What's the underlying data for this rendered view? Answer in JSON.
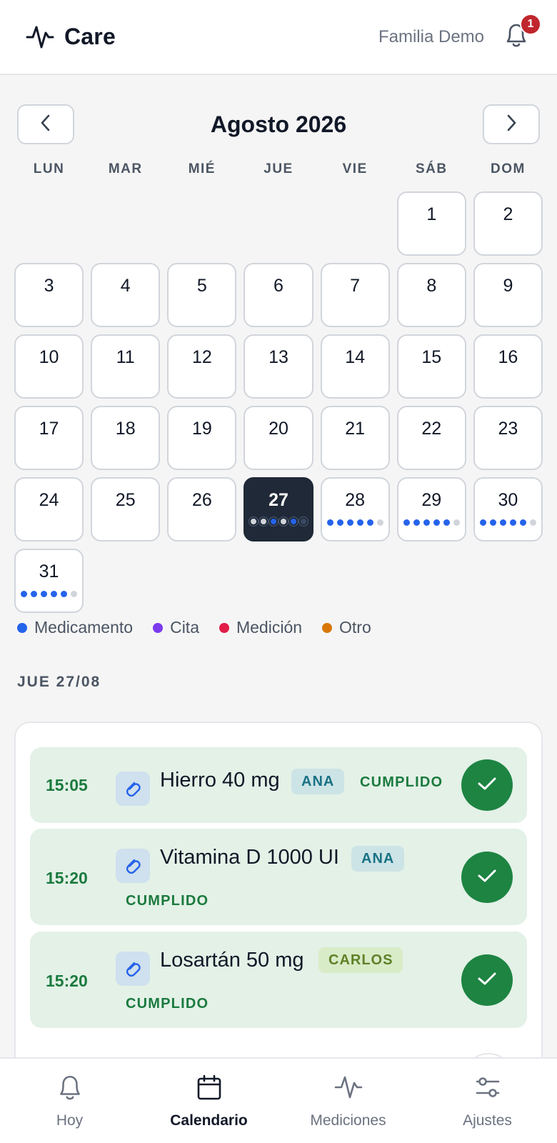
{
  "app": {
    "title": "Care",
    "family": "Familia Demo",
    "notifications": "1"
  },
  "calendar": {
    "month_title": "Agosto 2026",
    "weekdays": [
      "LUN",
      "MAR",
      "MIÉ",
      "JUE",
      "VIE",
      "SÁB",
      "DOM"
    ],
    "leading_blank_days": 5,
    "selected_day": 27,
    "days": [
      {
        "n": "1"
      },
      {
        "n": "2"
      },
      {
        "n": "3"
      },
      {
        "n": "4"
      },
      {
        "n": "5"
      },
      {
        "n": "6"
      },
      {
        "n": "7"
      },
      {
        "n": "8"
      },
      {
        "n": "9"
      },
      {
        "n": "10"
      },
      {
        "n": "11"
      },
      {
        "n": "12"
      },
      {
        "n": "13"
      },
      {
        "n": "14"
      },
      {
        "n": "15"
      },
      {
        "n": "16"
      },
      {
        "n": "17"
      },
      {
        "n": "18"
      },
      {
        "n": "19"
      },
      {
        "n": "20"
      },
      {
        "n": "21"
      },
      {
        "n": "22"
      },
      {
        "n": "23"
      },
      {
        "n": "24"
      },
      {
        "n": "25"
      },
      {
        "n": "26"
      },
      {
        "n": "27",
        "dots": [
          "pending",
          "pending",
          "done",
          "pending",
          "done",
          "empty"
        ]
      },
      {
        "n": "28",
        "dots": [
          "done",
          "done",
          "done",
          "done",
          "done",
          "pending"
        ]
      },
      {
        "n": "29",
        "dots": [
          "done",
          "done",
          "done",
          "done",
          "done",
          "pending"
        ]
      },
      {
        "n": "30",
        "dots": [
          "done",
          "done",
          "done",
          "done",
          "done",
          "pending"
        ]
      },
      {
        "n": "31",
        "dots": [
          "done",
          "done",
          "done",
          "done",
          "done",
          "pending"
        ]
      }
    ]
  },
  "legend": [
    {
      "label": "Medicamento",
      "color": "#2563eb"
    },
    {
      "label": "Cita",
      "color": "#7c3aed"
    },
    {
      "label": "Medición",
      "color": "#e11d48"
    },
    {
      "label": "Otro",
      "color": "#d97706"
    }
  ],
  "day_section": {
    "title": "JUE 27/08"
  },
  "events": [
    {
      "time": "15:05",
      "name": "Hierro 40 mg",
      "person": "ANA",
      "status": "CUMPLIDO"
    },
    {
      "time": "15:20",
      "name": "Vitamina D 1000 UI",
      "person": "ANA",
      "status": "CUMPLIDO"
    },
    {
      "time": "15:20",
      "name": "Losartán 50 mg",
      "person": "CARLOS",
      "status": "CUMPLIDO"
    }
  ],
  "bottom_nav": [
    {
      "label": "Hoy",
      "icon": "bell-icon"
    },
    {
      "label": "Calendario",
      "icon": "calendar-icon",
      "active": true
    },
    {
      "label": "Mediciones",
      "icon": "pulse-icon"
    },
    {
      "label": "Ajustes",
      "icon": "sliders-icon"
    }
  ]
}
